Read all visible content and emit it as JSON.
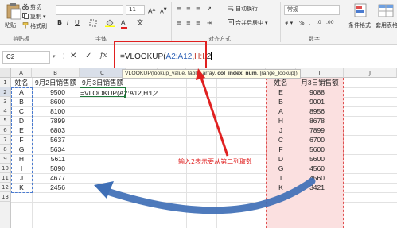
{
  "ribbon": {
    "clipboard": {
      "cut": "剪切",
      "copy": "复制",
      "format_painter": "格式刷",
      "paste": "粘贴",
      "group": "剪贴板"
    },
    "font": {
      "size": "11",
      "group": "字体"
    },
    "alignment": {
      "wrap": "自动换行",
      "merge": "合并后居中",
      "group": "对齐方式"
    },
    "number": {
      "format": "常规",
      "group": "数字"
    },
    "styles": {
      "cond": "条件格式",
      "table": "套用表格格式"
    }
  },
  "formula_bar": {
    "name_box": "C2",
    "cancel": "✕",
    "enter": "✓",
    "fx": "fx",
    "formula": "=VLOOKUP(A2:A12,H:I,2",
    "formula_parts": {
      "prefix": "=VLOOKUP(",
      "ref1": "A2:A12",
      "sep1": ",",
      "ref2": "H:I",
      "sep2": ",",
      "arg": "2"
    }
  },
  "tooltip": {
    "fn": "VLOOKUP(",
    "a1": "lookup_value, ",
    "a2": "table_array, ",
    "a3": "col_index_num",
    "a4": ", [range_lookup])"
  },
  "columns": [
    "A",
    "B",
    "C",
    "D",
    "E",
    "F",
    "G",
    "H",
    "I",
    "J"
  ],
  "rows": [
    "1",
    "2",
    "3",
    "4",
    "5",
    "6",
    "7",
    "8",
    "9",
    "10",
    "11",
    "12",
    "13"
  ],
  "headers": {
    "a": "姓名",
    "b": "9月2日销售额",
    "c": "9月3日销售额",
    "h": "姓名",
    "i": "月3日销售额"
  },
  "table_left": [
    {
      "name": "A",
      "value": "9500"
    },
    {
      "name": "B",
      "value": "8600"
    },
    {
      "name": "C",
      "value": "8100"
    },
    {
      "name": "D",
      "value": "7899"
    },
    {
      "name": "E",
      "value": "6803"
    },
    {
      "name": "F",
      "value": "5637"
    },
    {
      "name": "G",
      "value": "5634"
    },
    {
      "name": "H",
      "value": "5611"
    },
    {
      "name": "I",
      "value": "5090"
    },
    {
      "name": "J",
      "value": "4677"
    },
    {
      "name": "K",
      "value": "2456"
    }
  ],
  "editing_cell": "=VLOOKUP(A2:A12,H:I,2",
  "table_right": [
    {
      "name": "E",
      "value": "9088"
    },
    {
      "name": "B",
      "value": "9001"
    },
    {
      "name": "A",
      "value": "8956"
    },
    {
      "name": "H",
      "value": "8678"
    },
    {
      "name": "J",
      "value": "7899"
    },
    {
      "name": "C",
      "value": "6700"
    },
    {
      "name": "F",
      "value": "5600"
    },
    {
      "name": "D",
      "value": "5600"
    },
    {
      "name": "G",
      "value": "4560"
    },
    {
      "name": "I",
      "value": "4560"
    },
    {
      "name": "K",
      "value": "3421"
    }
  ],
  "annotation": "输入2表示要从第二列取数",
  "colors": {
    "accent_red": "#e02020",
    "dash_blue": "#4a7bd0",
    "range_green": "#1e7a3a",
    "right_fill": "#fbe0e0",
    "arrow_blue": "#3f6fb6"
  }
}
